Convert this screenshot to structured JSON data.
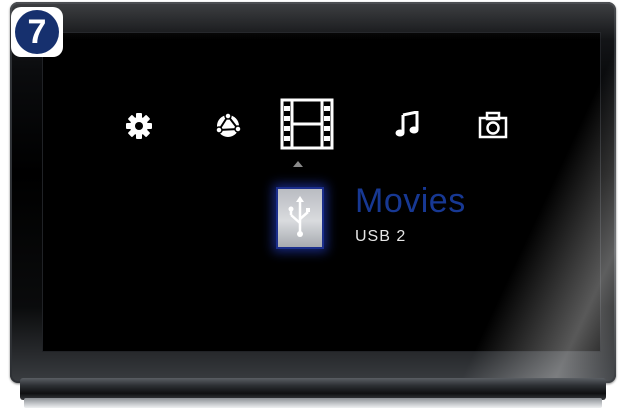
{
  "step_badge": {
    "number": "7",
    "color": "#16306e"
  },
  "menu": {
    "items": [
      {
        "icon": "gear-icon",
        "selected": false
      },
      {
        "icon": "network-globe-icon",
        "selected": false
      },
      {
        "icon": "film-icon",
        "selected": true
      },
      {
        "icon": "music-note-icon",
        "selected": false
      },
      {
        "icon": "camera-icon",
        "selected": false
      }
    ]
  },
  "focus": {
    "title": "Movies",
    "source": "USB 2",
    "device_icon": "usb-icon",
    "accent_color": "#173893"
  }
}
